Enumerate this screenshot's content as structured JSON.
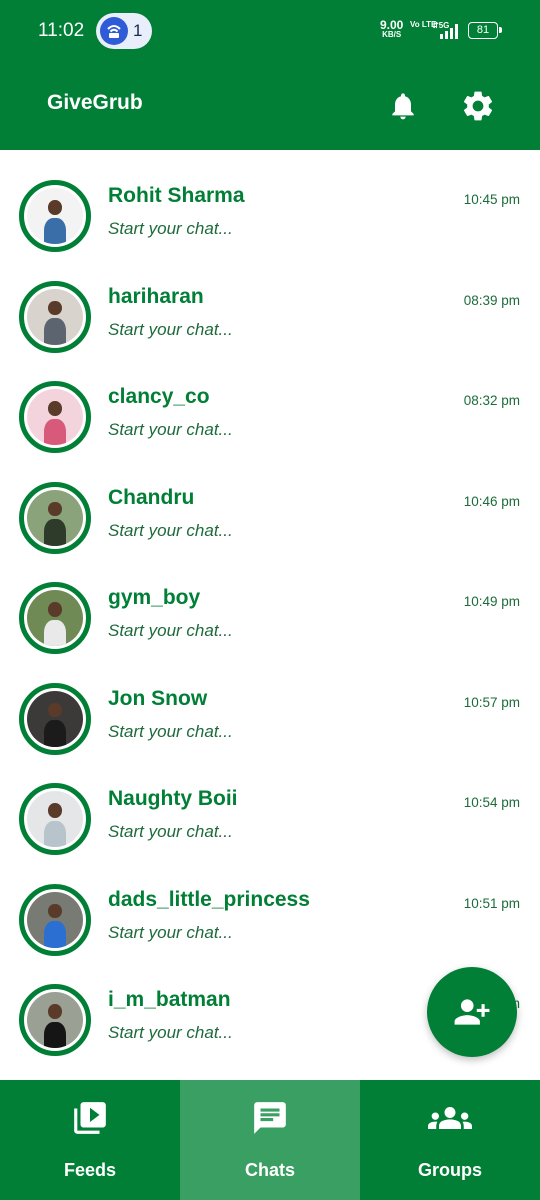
{
  "status_bar": {
    "time": "11:02",
    "notification_count": "1",
    "net_speed": "9.00",
    "net_unit": "KB/S",
    "volte": "Vo LTE",
    "network": "5G",
    "battery": "81"
  },
  "app": {
    "title": "GiveGrub",
    "bell_icon": "bell-icon",
    "settings_icon": "gear-icon"
  },
  "chats": [
    {
      "name": "Rohit Sharma",
      "message": "Start your chat...",
      "time": "10:45 pm",
      "avatar_colors": [
        "#3a6ea8",
        "#f3f3f3"
      ]
    },
    {
      "name": "hariharan",
      "message": "Start your chat...",
      "time": "08:39 pm",
      "avatar_colors": [
        "#5c6470",
        "#d8d3cc"
      ]
    },
    {
      "name": "clancy_co",
      "message": "Start your chat...",
      "time": "08:32 pm",
      "avatar_colors": [
        "#d85a7a",
        "#f3d4dc"
      ]
    },
    {
      "name": "Chandru",
      "message": "Start your chat...",
      "time": "10:46 pm",
      "avatar_colors": [
        "#2e3b2b",
        "#8aa37a"
      ]
    },
    {
      "name": "gym_boy",
      "message": "Start your chat...",
      "time": "10:49 pm",
      "avatar_colors": [
        "#e9e9e9",
        "#6f8a55"
      ]
    },
    {
      "name": "Jon Snow",
      "message": "Start your chat...",
      "time": "10:57 pm",
      "avatar_colors": [
        "#1b1b1b",
        "#3b3a38"
      ]
    },
    {
      "name": "Naughty Boii",
      "message": "Start your chat...",
      "time": "10:54 pm",
      "avatar_colors": [
        "#b7c4cc",
        "#e4e6e8"
      ]
    },
    {
      "name": "dads_little_princess",
      "message": "Start your chat...",
      "time": "10:51 pm",
      "avatar_colors": [
        "#2a6fd1",
        "#777b74"
      ]
    },
    {
      "name": "i_m_batman",
      "message": "Start your chat...",
      "time": "10:5_ pm",
      "avatar_colors": [
        "#151515",
        "#9aa094"
      ]
    }
  ],
  "fab": {
    "icon": "add-user-icon"
  },
  "bottom_nav": [
    {
      "label": "Feeds",
      "icon": "video-library-icon",
      "active": false
    },
    {
      "label": "Chats",
      "icon": "chat-icon",
      "active": true
    },
    {
      "label": "Groups",
      "icon": "groups-icon",
      "active": false
    }
  ],
  "colors": {
    "brand": "#017f36",
    "nav_active": "#3a9f62",
    "text_green": "#1d6b3a"
  }
}
